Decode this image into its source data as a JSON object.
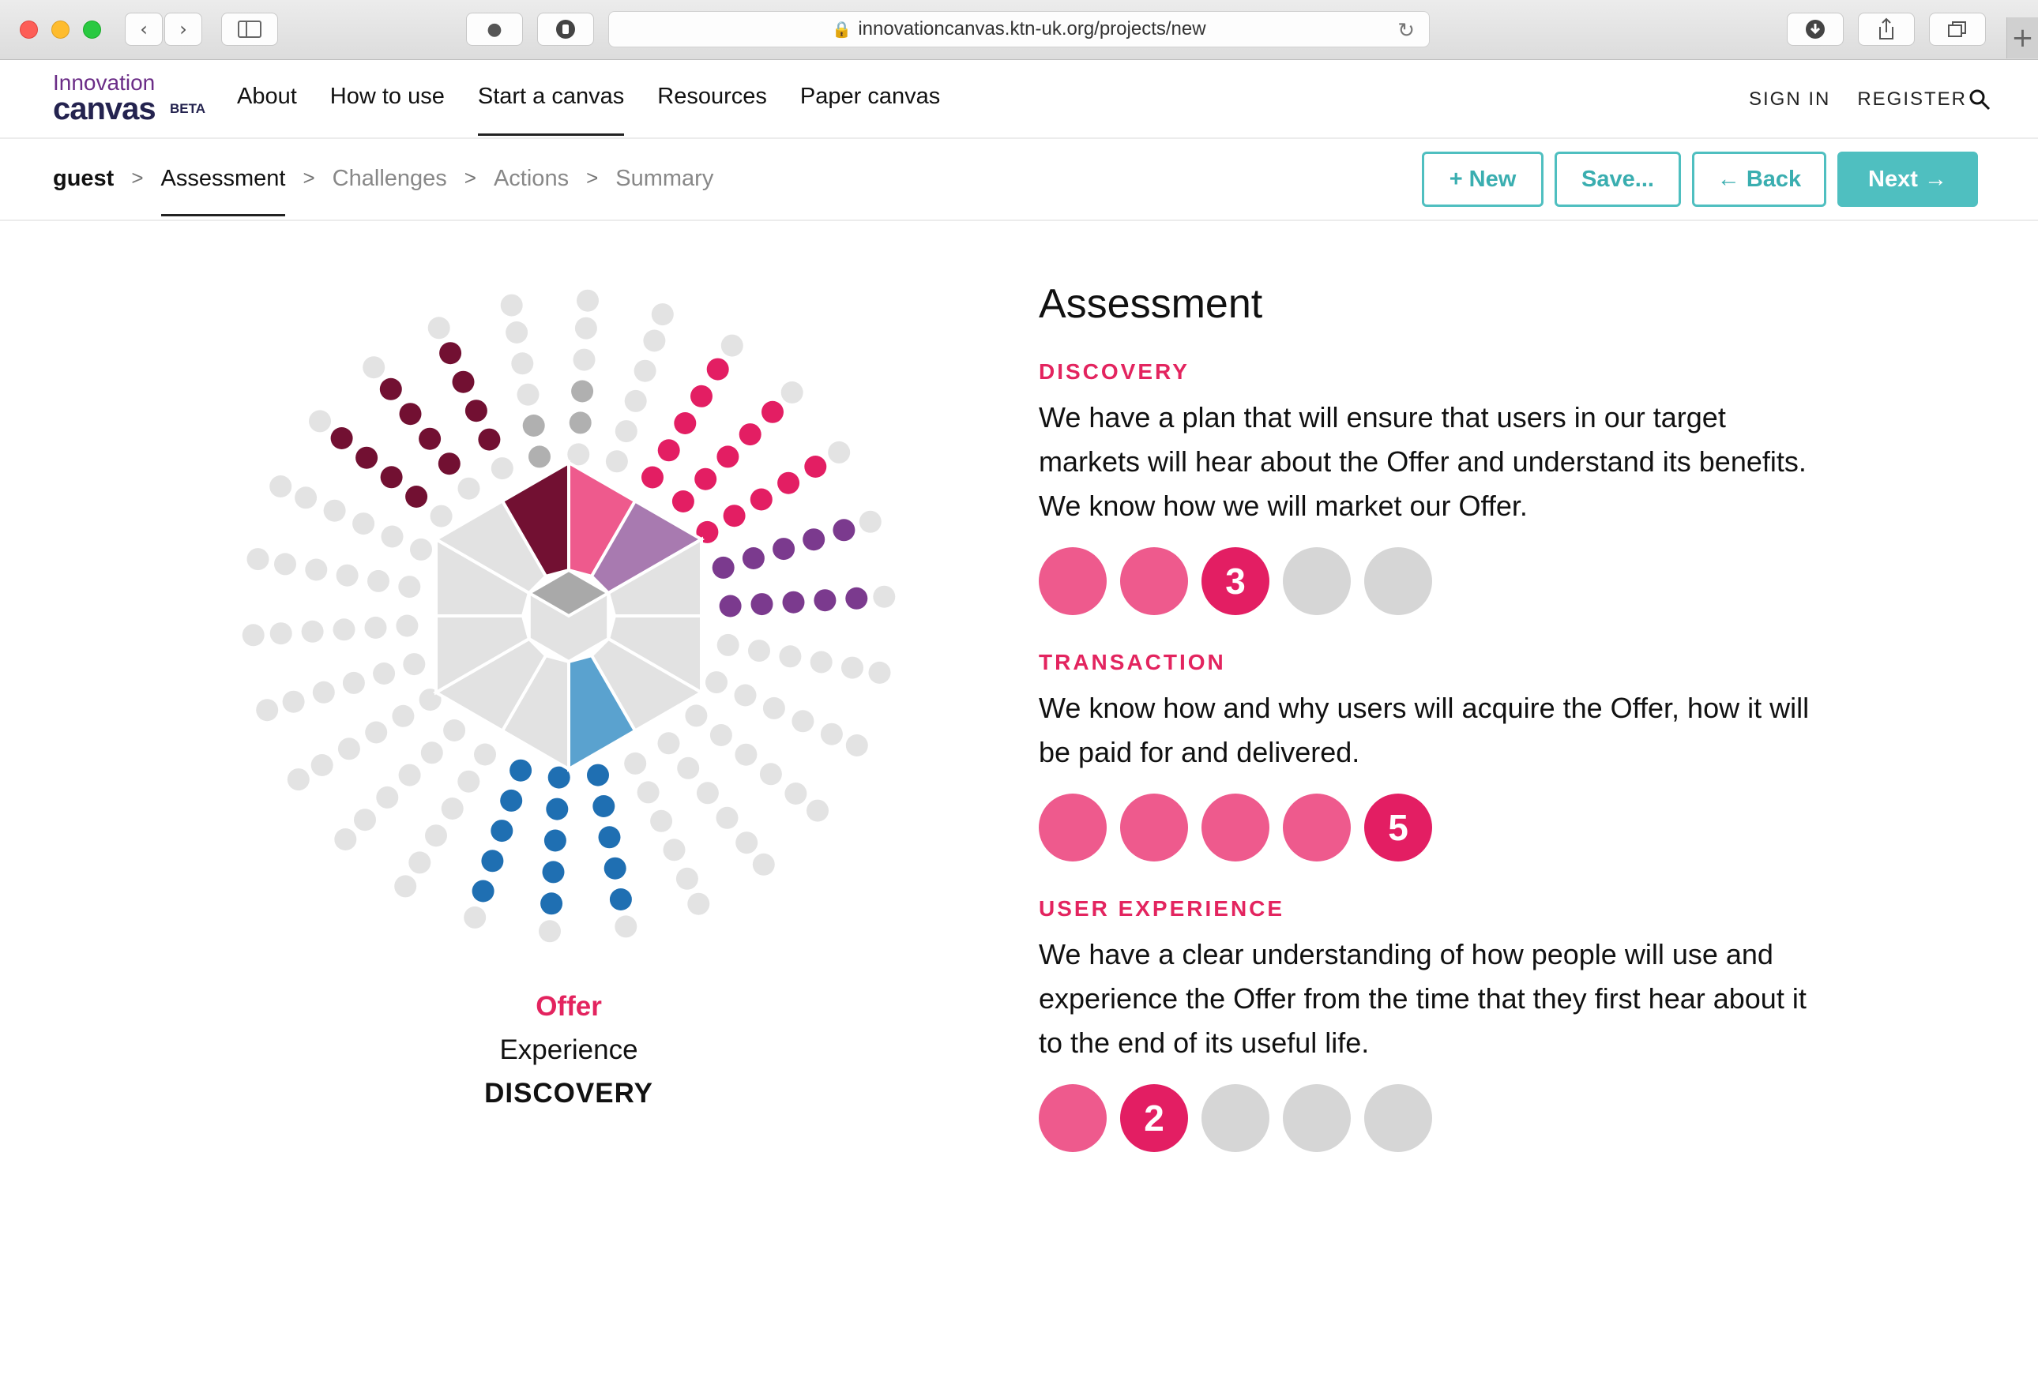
{
  "browser": {
    "url": "innovationcanvas.ktn-uk.org/projects/new"
  },
  "header": {
    "logo_top": "Innovation",
    "logo_bottom": "canvas",
    "logo_badge": "BETA",
    "nav": [
      "About",
      "How to use",
      "Start a canvas",
      "Resources",
      "Paper canvas"
    ],
    "sign_in": "SIGN IN",
    "register": "REGISTER"
  },
  "breadcrumb": {
    "user": "guest",
    "steps": [
      "Assessment",
      "Challenges",
      "Actions",
      "Summary"
    ],
    "separator": ">"
  },
  "actions": {
    "new_label": "+ New",
    "save_label": "Save...",
    "back_label": "← Back",
    "next_label": "Next →"
  },
  "diagram": {
    "caption_offer": "Offer",
    "caption_experience": "Experience",
    "caption_section": "DISCOVERY"
  },
  "assessment": {
    "title": "Assessment",
    "sections": [
      {
        "category": "DISCOVERY",
        "description": "We have a plan that will ensure that users in our target markets will hear about the Offer and understand its benefits. We know how we will market our Offer.",
        "score": 3,
        "max": 5,
        "score_label": "3"
      },
      {
        "category": "TRANSACTION",
        "description": "We know how and why users will acquire the Offer, how it will be paid for and delivered.",
        "score": 5,
        "max": 5,
        "score_label": "5"
      },
      {
        "category": "USER EXPERIENCE",
        "description": "We have a clear understanding of how people will use and experience the Offer from the time that they first hear about it to the end of its useful life.",
        "score": 2,
        "max": 5,
        "score_label": "2"
      }
    ]
  },
  "colors": {
    "accent_pink": "#e3245f",
    "dot_on": "#ee5a8d",
    "dot_off": "#d6d6d6",
    "teal": "#4fbfc0",
    "maroon": "#721032",
    "purple": "#7b3a8e",
    "blue": "#1f6fb2"
  }
}
